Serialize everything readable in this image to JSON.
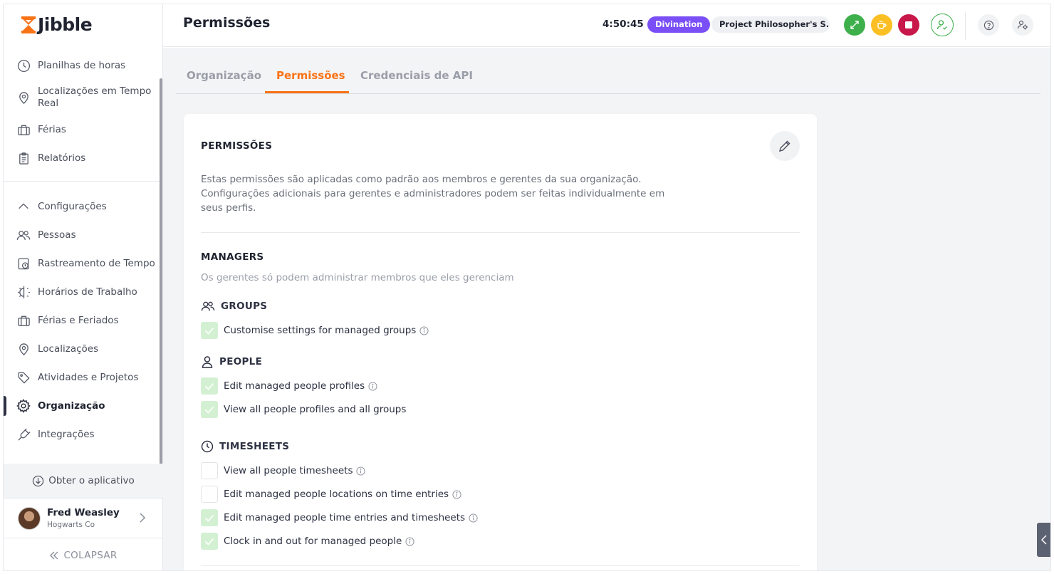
{
  "app": {
    "brand": "Jibble"
  },
  "sidebar": {
    "top_items": [
      {
        "label": "Planilhas de horas",
        "icon": "clock-icon"
      },
      {
        "label": "Localizações em Tempo Real",
        "icon": "map-pin-icon"
      },
      {
        "label": "Férias",
        "icon": "briefcase-icon"
      },
      {
        "label": "Relatórios",
        "icon": "clipboard-icon"
      }
    ],
    "settings_label": "Configurações",
    "settings_items": [
      {
        "label": "Pessoas",
        "icon": "people-icon"
      },
      {
        "label": "Rastreamento de Tempo",
        "icon": "time-tracking-icon"
      },
      {
        "label": "Horários de Trabalho",
        "icon": "work-schedule-icon"
      },
      {
        "label": "Férias e Feriados",
        "icon": "briefcase-icon"
      },
      {
        "label": "Localizações",
        "icon": "map-pin-icon"
      },
      {
        "label": "Atividades e Projetos",
        "icon": "tag-icon"
      },
      {
        "label": "Organização",
        "icon": "gear-icon",
        "active": true
      },
      {
        "label": "Integrações",
        "icon": "plug-icon"
      }
    ],
    "get_app": "Obter o aplicativo",
    "user": {
      "name": "Fred Weasley",
      "org": "Hogwarts Co"
    },
    "collapse": "COLAPSAR"
  },
  "header": {
    "title": "Permissões",
    "timer": "4:50:45",
    "activity": "Divination",
    "project": "Project Philosopher's S...",
    "colors": {
      "activity": "#7a4ff7",
      "green": "#3db04b",
      "yellow": "#fbbf24",
      "red": "#c8174a"
    }
  },
  "tabs": [
    {
      "label": "Organização",
      "active": false
    },
    {
      "label": "Permissões",
      "active": true
    },
    {
      "label": "Credenciais de API",
      "active": false
    }
  ],
  "card": {
    "title": "PERMISSÕES",
    "description_line1": "Estas permissões são aplicadas como padrão aos membros e gerentes da sua organização.",
    "description_line2": "Configurações adicionais para gerentes e administradores podem ser feitas individualmente em seus perfis.",
    "managers": {
      "title": "MANAGERS",
      "subtitle": "Os gerentes só podem administrar membros que eles gerenciam",
      "groups": [
        {
          "title": "GROUPS",
          "icon": "people-icon",
          "items": [
            {
              "label": "Customise settings for managed groups",
              "checked": true,
              "info": true
            }
          ]
        },
        {
          "title": "PEOPLE",
          "icon": "person-icon",
          "items": [
            {
              "label": "Edit managed people profiles",
              "checked": true,
              "info": true
            },
            {
              "label": "View all people profiles and all groups",
              "checked": true,
              "info": false
            }
          ]
        },
        {
          "title": "TIMESHEETS",
          "icon": "clock-icon",
          "items": [
            {
              "label": "View all people timesheets",
              "checked": false,
              "info": true
            },
            {
              "label": "Edit managed people locations on time entries",
              "checked": false,
              "info": true
            },
            {
              "label": "Edit managed people time entries and timesheets",
              "checked": true,
              "info": true
            },
            {
              "label": "Clock in and out for managed people",
              "checked": true,
              "info": true
            }
          ]
        }
      ]
    }
  }
}
